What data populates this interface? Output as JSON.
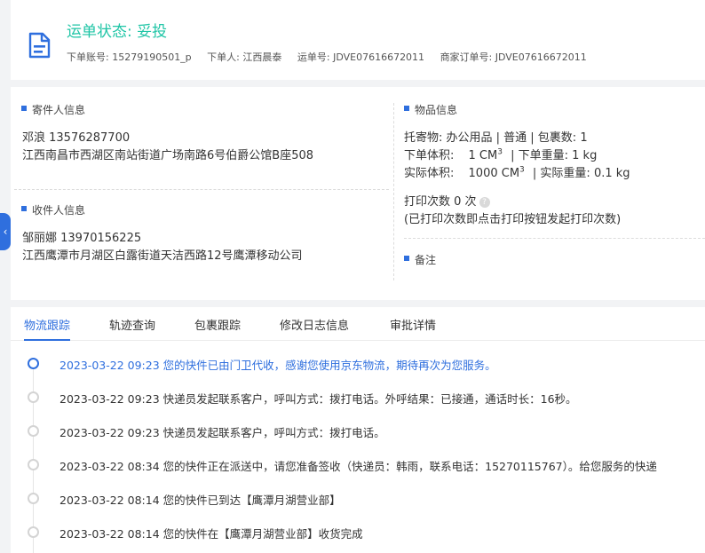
{
  "header": {
    "status": "运单状态: 妥投",
    "meta": [
      "下单账号: 15279190501_p",
      "下单人: 江西晨泰",
      "运单号: JDVE07616672011",
      "商家订单号: JDVE07616672011"
    ]
  },
  "sender": {
    "title": "寄件人信息",
    "name_phone": "邓浪   13576287700",
    "address": "江西南昌市西湖区南站街道广场南路6号伯爵公馆B座508"
  },
  "receiver": {
    "title": "收件人信息",
    "name_phone": "邹丽娜   13970156225",
    "address": "江西鹰潭市月湖区白露街道天洁西路12号鹰潭移动公司"
  },
  "goods": {
    "title": "物品信息",
    "line1": "托寄物:  办公用品 | 普通 | 包裹数:  1",
    "order_volume_label": "下单体积:",
    "order_volume_value": "1 CM",
    "order_weight": "| 下单重量:  1 kg",
    "actual_volume_label": "实际体积:",
    "actual_volume_value": "1000 CM",
    "actual_weight": "| 实际重量:  0.1 kg",
    "unit_sup": "3",
    "print_count": "打印次数   0 次",
    "print_hint_icon": "?",
    "print_hint": "(已打印次数即点击打印按钮发起打印次数)"
  },
  "remark": {
    "title": "备注"
  },
  "side_toggle": "‹",
  "tabs": [
    "物流跟踪",
    "轨迹查询",
    "包裹跟踪",
    "修改日志信息",
    "审批详情"
  ],
  "timeline": [
    "2023-03-22 09:23  您的快件已由门卫代收，感谢您使用京东物流，期待再次为您服务。",
    "2023-03-22 09:23  快递员发起联系客户，呼叫方式：拨打电话。外呼结果：已接通，通话时长：16秒。",
    "2023-03-22 09:23  快递员发起联系客户，呼叫方式：拨打电话。",
    "2023-03-22 08:34  您的快件正在派送中，请您准备签收（快递员：韩雨，联系电话：15270115767）。给您服务的快递",
    "2023-03-22 08:14  您的快件已到达【鹰潭月湖营业部】",
    "2023-03-22 08:14  您的快件在【鹰潭月湖营业部】收货完成"
  ],
  "colors": {
    "accent": "#2f6fde",
    "status": "#1fc5a6"
  }
}
